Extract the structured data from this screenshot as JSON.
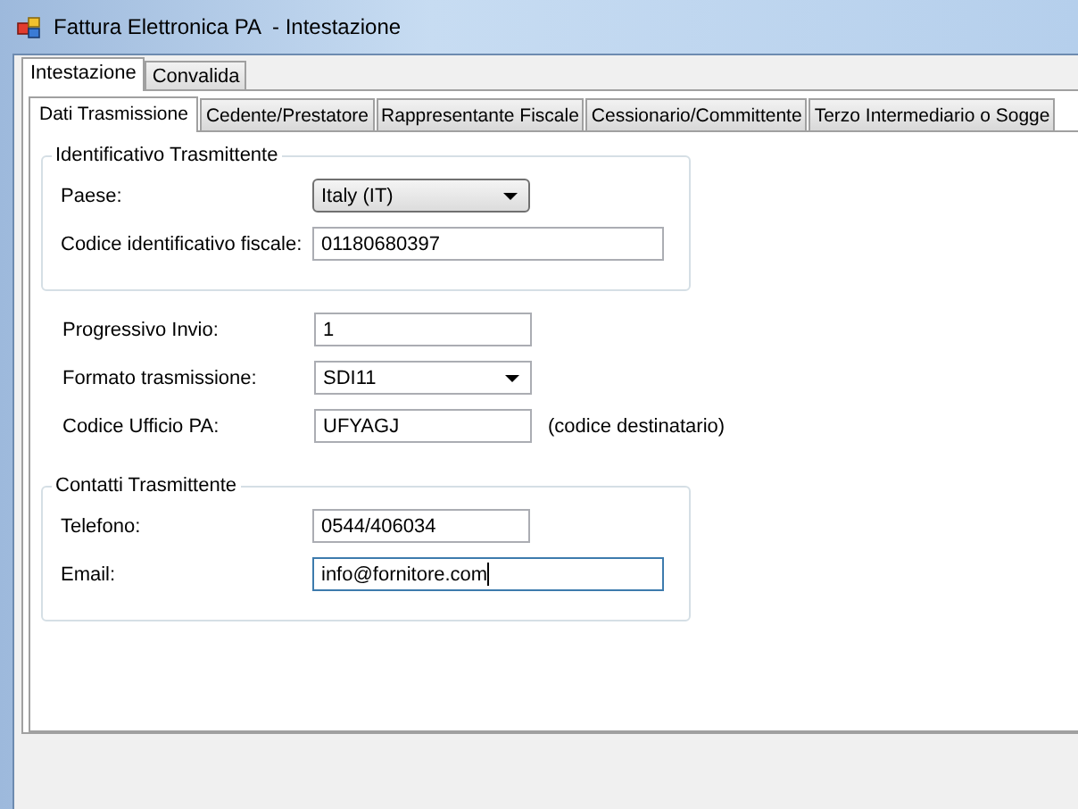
{
  "window": {
    "title": "Fattura Elettronica PA  - Intestazione"
  },
  "tabs": [
    {
      "label": "Intestazione",
      "selected": true
    },
    {
      "label": "Convalida",
      "selected": false
    }
  ],
  "subtabs": [
    {
      "label": "Dati Trasmissione",
      "selected": true
    },
    {
      "label": "Cedente/Prestatore",
      "selected": false
    },
    {
      "label": "Rappresentante Fiscale",
      "selected": false
    },
    {
      "label": "Cessionario/Committente",
      "selected": false
    },
    {
      "label": "Terzo Intermediario o Sogge",
      "selected": false
    }
  ],
  "sections": [
    {
      "kind": "group",
      "title": "Identificativo Trasmittente",
      "fields": [
        {
          "kind": "combo-button",
          "label": "Paese:",
          "value": "Italy (IT)",
          "focused": false
        },
        {
          "kind": "wide-text",
          "label": "Codice identificativo fiscale:",
          "value": "01180680397",
          "focused": false
        }
      ]
    },
    {
      "kind": "plain",
      "fields": [
        {
          "kind": "text",
          "label": "Progressivo Invio:",
          "value": "1",
          "focused": false
        },
        {
          "kind": "combo",
          "label": "Formato trasmissione:",
          "value": "SDI11",
          "focused": false
        },
        {
          "kind": "text",
          "label": "Codice Ufficio PA:",
          "value": "UFYAGJ",
          "note": "(codice destinatario)",
          "focused": false
        }
      ]
    },
    {
      "kind": "group",
      "title": "Contatti Trasmittente",
      "fields": [
        {
          "kind": "text",
          "label": "Telefono:",
          "value": "0544/406034",
          "focused": false
        },
        {
          "kind": "wide-text",
          "label": "Email:",
          "value": "info@fornitore.com",
          "focused": true
        }
      ]
    }
  ]
}
